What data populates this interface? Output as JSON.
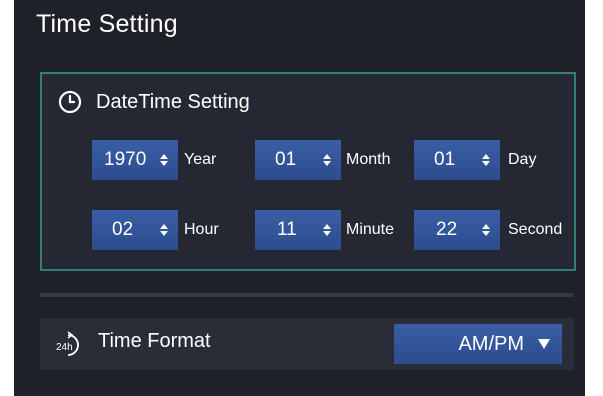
{
  "title": "Time Setting",
  "datetime": {
    "header": "DateTime Setting",
    "icon": "clock-icon",
    "fields": {
      "year": {
        "value": "1970",
        "unit": "Year"
      },
      "month": {
        "value": "01",
        "unit": "Month"
      },
      "day": {
        "value": "01",
        "unit": "Day"
      },
      "hour": {
        "value": "02",
        "unit": "Hour"
      },
      "minute": {
        "value": "11",
        "unit": "Minute"
      },
      "second": {
        "value": "22",
        "unit": "Second"
      }
    }
  },
  "time_format": {
    "label": "Time Format",
    "icon": "24h-clock-icon",
    "icon_text": "24h",
    "selected": "AM/PM"
  },
  "colors": {
    "panel_bg": "#1f2128",
    "box_border": "#347d79",
    "control_bg": "#3a5ea6",
    "text": "#ffffff"
  }
}
